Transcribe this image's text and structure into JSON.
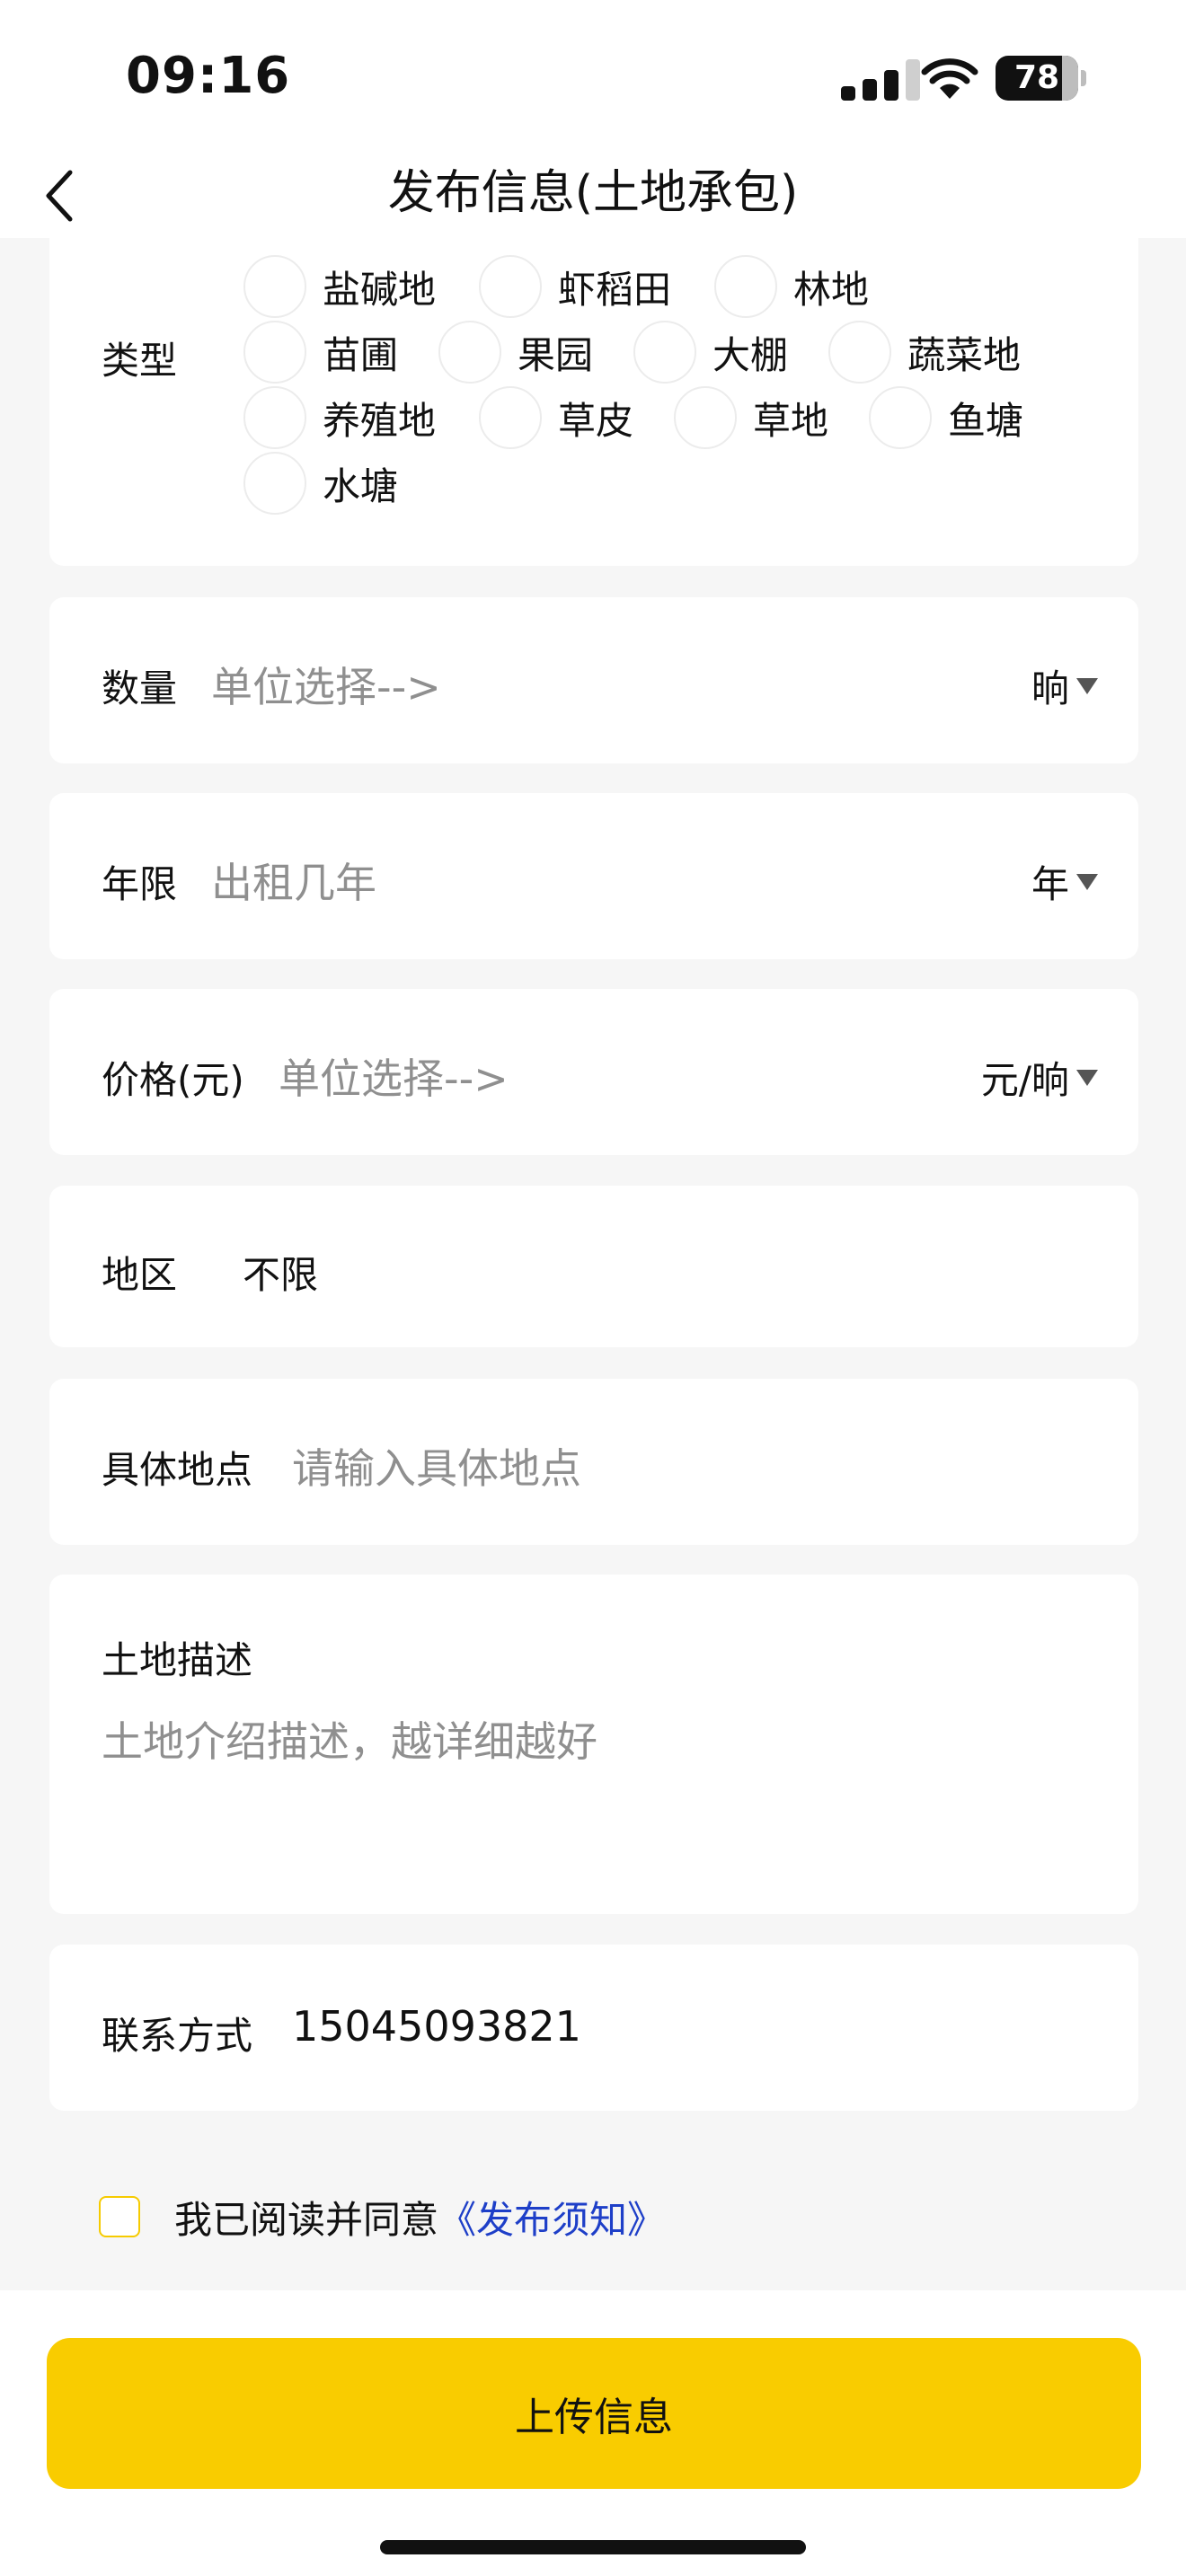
{
  "status_bar": {
    "time": "09:16",
    "battery": "78"
  },
  "nav": {
    "title": "发布信息(土地承包)",
    "back_icon": "chevron-left-icon"
  },
  "type": {
    "label": "类型",
    "options_row1": [
      "盐碱地",
      "虾稻田",
      "林地"
    ],
    "options_row2": [
      "苗圃",
      "果园",
      "大棚",
      "蔬菜地"
    ],
    "options_row3": [
      "养殖地",
      "草皮",
      "草地",
      "鱼塘"
    ],
    "options_row4": [
      "水塘"
    ]
  },
  "quantity": {
    "label": "数量",
    "placeholder": "单位选择-->",
    "unit": "晌"
  },
  "years": {
    "label": "年限",
    "placeholder": "出租几年",
    "unit": "年"
  },
  "price": {
    "label": "价格(元)",
    "placeholder": "单位选择-->",
    "unit": "元/晌"
  },
  "region": {
    "label": "地区",
    "value": "不限"
  },
  "location": {
    "label": "具体地点",
    "placeholder": "请输入具体地点"
  },
  "description": {
    "label": "土地描述",
    "placeholder": "土地介绍描述，越详细越好"
  },
  "contact": {
    "label": "联系方式",
    "value": "15045093821"
  },
  "agreement": {
    "text": "我已阅读并同意",
    "link": "《发布须知》"
  },
  "submit": {
    "label": "上传信息"
  },
  "colors": {
    "accent": "#f9cc00",
    "link": "#1e3fc8",
    "placeholder": "#8f8f8f",
    "page_bg": "#f6f6f6"
  }
}
